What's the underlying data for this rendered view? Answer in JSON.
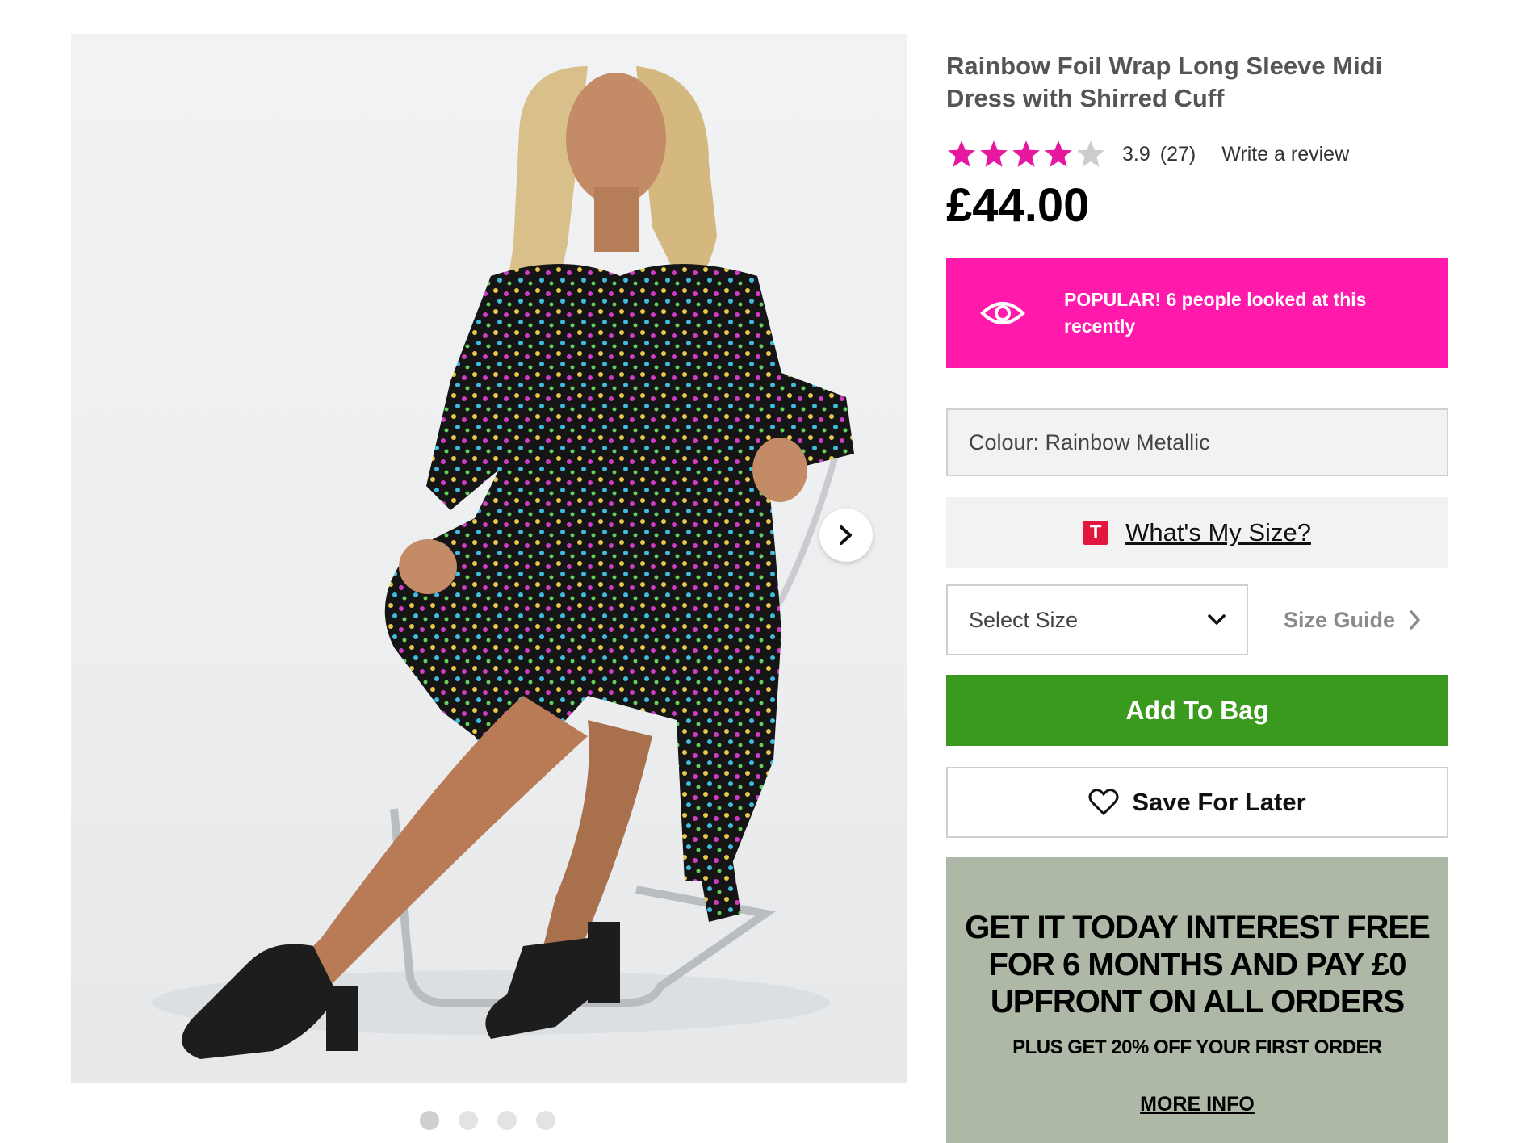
{
  "product": {
    "title": "Rainbow Foil Wrap Long Sleeve Midi Dress with Shirred Cuff",
    "rating_value": "3.9",
    "rating_count": "(27)",
    "rating_fraction": 0.78,
    "review_link": "Write a review",
    "price": "£44.00"
  },
  "popular_banner": {
    "icon": "eye-icon",
    "message": "POPULAR! 6 people looked at this recently",
    "color": "#ff1aab"
  },
  "colour": {
    "label": "Colour: Rainbow Metallic"
  },
  "fit_tool": {
    "badge": "T",
    "label": "What's My Size?"
  },
  "size": {
    "select_label": "Select Size",
    "guide_label": "Size Guide"
  },
  "actions": {
    "add_to_bag": "Add To Bag",
    "add_to_bag_color": "#3a9a1e",
    "save_for_later": "Save For Later"
  },
  "promo": {
    "headline": "GET IT TODAY INTEREST FREE FOR 6 MONTHS AND PAY £0 UPFRONT ON ALL ORDERS",
    "subline": "PLUS GET 20% OFF YOUR FIRST ORDER",
    "link": "MORE INFO",
    "background": "#adb9a6"
  },
  "gallery": {
    "image_count": 4,
    "active_index": 0
  },
  "colors": {
    "star": "#e6189f",
    "star_empty": "#cccccc"
  }
}
